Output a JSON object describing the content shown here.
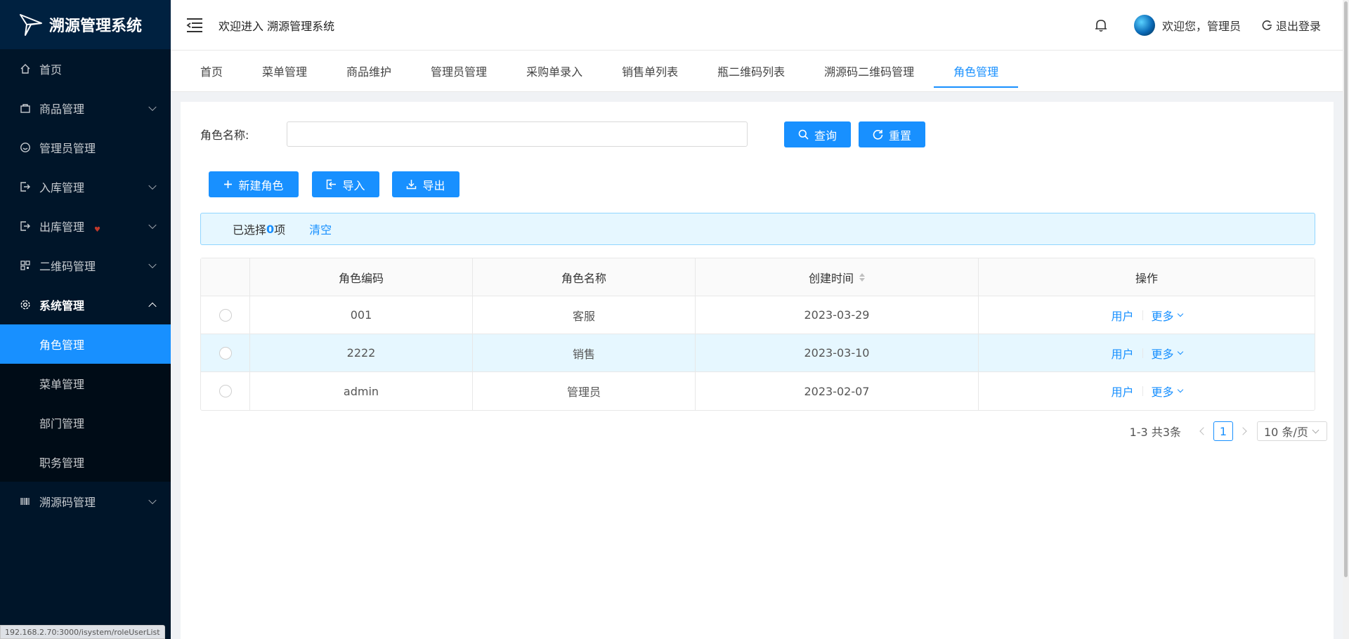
{
  "app": {
    "name": "溯源管理系统"
  },
  "sidebar": {
    "items": [
      {
        "label": "首页",
        "icon": "home-icon"
      },
      {
        "label": "商品管理",
        "icon": "shopping-bag-icon"
      },
      {
        "label": "管理员管理",
        "icon": "smile-icon"
      },
      {
        "label": "入库管理",
        "icon": "login-icon"
      },
      {
        "label": "出库管理",
        "icon": "logout-icon"
      },
      {
        "label": "二维码管理",
        "icon": "qrcode-icon"
      },
      {
        "label": "系统管理",
        "icon": "setting-icon"
      },
      {
        "label": "溯源码管理",
        "icon": "barcode-icon"
      }
    ],
    "system_submenu": [
      "角色管理",
      "菜单管理",
      "部门管理",
      "职务管理"
    ],
    "active": "角色管理"
  },
  "header": {
    "welcome": "欢迎进入 溯源管理系统",
    "user_greeting": "欢迎您，管理员",
    "logout": "退出登录"
  },
  "tabs": [
    "首页",
    "菜单管理",
    "商品维护",
    "管理员管理",
    "采购单录入",
    "销售单列表",
    "瓶二维码列表",
    "溯源码二维码管理",
    "角色管理"
  ],
  "active_tab": "角色管理",
  "search": {
    "label": "角色名称:",
    "value": "",
    "query_button": "查询",
    "reset_button": "重置"
  },
  "toolbar": {
    "new_button": "新建角色",
    "import_button": "导入",
    "export_button": "导出"
  },
  "selection": {
    "prefix": "已选择",
    "count": "0",
    "suffix": "项",
    "clear": "清空"
  },
  "table": {
    "columns": [
      "角色编码",
      "角色名称",
      "创建时间",
      "操作"
    ],
    "rows": [
      {
        "code": "001",
        "name": "客服",
        "created": "2023-03-29"
      },
      {
        "code": "2222",
        "name": "销售",
        "created": "2023-03-10"
      },
      {
        "code": "admin",
        "name": "管理员",
        "created": "2023-02-07"
      }
    ],
    "action_user": "用户",
    "action_more": "更多"
  },
  "pagination": {
    "total_text": "1-3 共3条",
    "current": "1",
    "page_size": "10 条/页"
  },
  "status_url": "192.168.2.70:3000/isystem/roleUserList",
  "colors": {
    "primary": "#1890ff",
    "sidebar_bg": "#001529",
    "submenu_bg": "#000c17"
  }
}
